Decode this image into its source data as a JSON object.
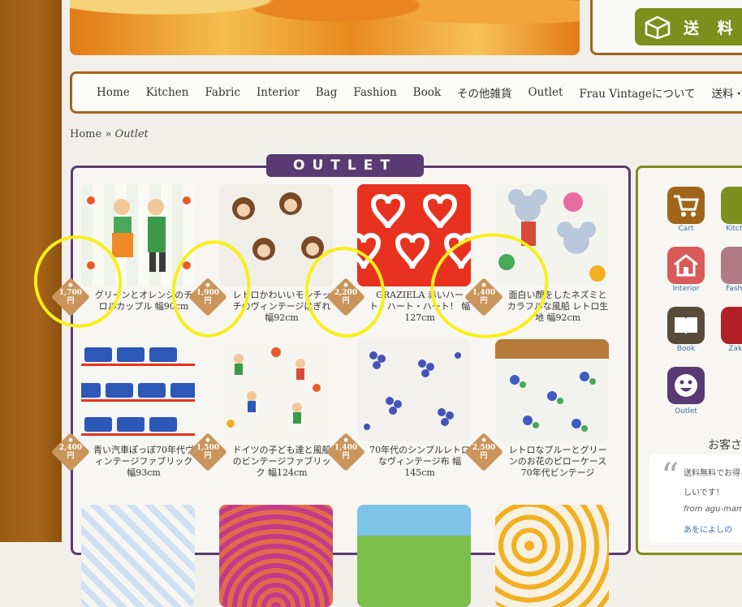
{
  "header": {
    "shipping_label": "送 料"
  },
  "nav": {
    "items": [
      "Home",
      "Kitchen",
      "Fabric",
      "Interior",
      "Bag",
      "Fashion",
      "Book",
      "その他雑貨",
      "Outlet",
      "Frau Vintageについて",
      "送料・配送"
    ]
  },
  "breadcrumb": {
    "home": "Home",
    "sep": "»",
    "current": "Outlet"
  },
  "outlet": {
    "title": "OUTLET"
  },
  "products": [
    {
      "name": "グリーンとオレンジのチロルカップル 幅90cm",
      "price": "1,700",
      "unit": "円"
    },
    {
      "name": "レトロかわいいモンチッチのヴィンテージはぎれ 幅92cm",
      "price": "1,900",
      "unit": "円"
    },
    {
      "name": "GRAZIELA 赤いハート・ハート・ハート！ 幅127cm",
      "price": "2,200",
      "unit": "円"
    },
    {
      "name": "面白い顔をしたネズミとカラフルな風船 レトロ生地 幅92cm",
      "price": "1,400",
      "unit": "円"
    },
    {
      "name": "青い汽車ぽっぽ70年代ヴィンテージファブリック 幅93cm",
      "price": "2,400",
      "unit": "円"
    },
    {
      "name": "ドイツの子ども達と風船のビンテージファブリック 幅124cm",
      "price": "1,500",
      "unit": "円"
    },
    {
      "name": "70年代のシンプルレトロなヴィンテージ布 幅145cm",
      "price": "1,400",
      "unit": "円"
    },
    {
      "name": "レトロなブルーとグリーンのお花のピローケース70年代ビンテージ",
      "price": "2,500",
      "unit": "円"
    }
  ],
  "sidebar": {
    "icons": [
      {
        "label": "Cart",
        "color": "#a0651b",
        "icon": "cart-icon"
      },
      {
        "label": "Kitchen",
        "color": "#7d8f1c",
        "icon": "kitchen-icon"
      },
      {
        "label": "Interior",
        "color": "#d95a5a",
        "icon": "house-icon"
      },
      {
        "label": "Fashion",
        "color": "#b07a86",
        "icon": "fashion-icon"
      },
      {
        "label": "Book",
        "color": "#5a4a3a",
        "icon": "book-icon"
      },
      {
        "label": "Zakka",
        "color": "#b3202a",
        "icon": "flower-icon"
      },
      {
        "label": "Outlet",
        "color": "#5a3a72",
        "icon": "smiley-icon"
      }
    ],
    "review_title": "お客さ",
    "review_lines": [
      "送料無料でお得",
      "しいです！",
      "from agu-mam",
      "あをによしの"
    ]
  },
  "colors": {
    "brown": "#a0651b",
    "purple": "#5a3a72",
    "olive": "#7d8f1c",
    "tag": "#c9955a",
    "highlight": "#f8ef1a"
  }
}
